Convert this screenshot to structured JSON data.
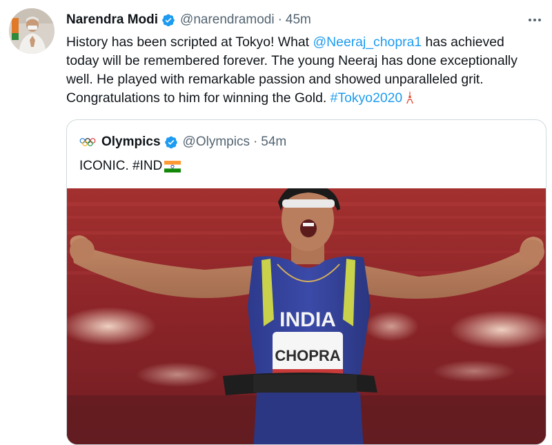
{
  "tweet": {
    "author_name": "Narendra Modi",
    "handle": "@narendramodi",
    "separator": "·",
    "time": "45m",
    "text_lines": [
      [
        "History has been scripted at Tokyo! What ",
        "@Neeraj_chopra1",
        " has achieved"
      ],
      "today will be remembered forever. The young Neeraj has done exceptionally",
      "well. He played with remarkable passion and showed unparalleled grit.",
      [
        "Congratulations to him for winning the Gold. ",
        "#Tokyo2020"
      ]
    ],
    "mention": "@Neeraj_chopra1",
    "hashtag": "#Tokyo2020"
  },
  "quote": {
    "author_name": "Olympics",
    "handle": "@Olympics",
    "separator": "·",
    "time": "54m",
    "text": "ICONIC. #IND"
  },
  "photo": {
    "jersey_text": "INDIA",
    "bib_text": "CHOPRA"
  },
  "colors": {
    "link": "#1d9bf0",
    "verified": "#1d9bf0",
    "secondary_text": "#536471",
    "border": "#cfd9de"
  },
  "icons": [
    "verified-badge-icon",
    "more-options-icon",
    "tokyo-tower-icon",
    "olympic-rings-icon",
    "india-flag-icon"
  ]
}
